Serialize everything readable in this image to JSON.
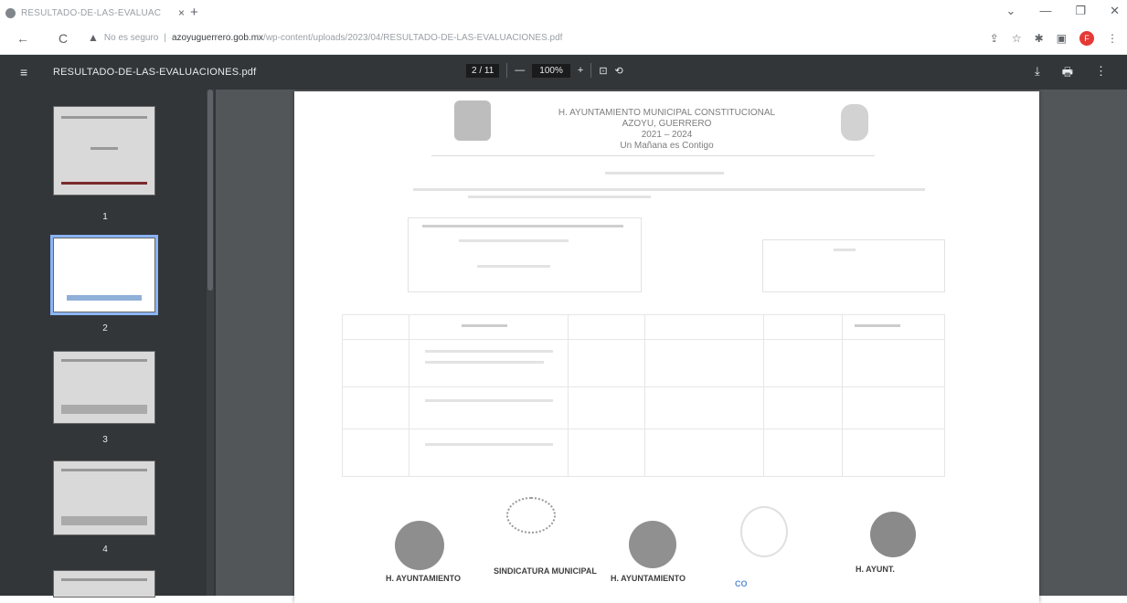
{
  "browser": {
    "tab_title": "RESULTADO-DE-LAS-EVALUAC",
    "tab_close": "×",
    "new_tab": "+",
    "security_label": "No es seguro",
    "url_host": "azoyuguerrero.gob.mx",
    "url_path": "/wp-content/uploads/2023/04/RESULTADO-DE-LAS-EVALUACIONES.pdf",
    "profile_initial": "F",
    "controls": {
      "back": "←",
      "reload": "C",
      "minimize": "—",
      "close": "✕"
    }
  },
  "pdf_toolbar": {
    "menu_icon": "≡",
    "file_name": "RESULTADO-DE-LAS-EVALUACIONES.pdf",
    "current_page": "2",
    "page_separator": "/",
    "total_pages": "11",
    "zoom_out": "—",
    "zoom_level": "100%",
    "zoom_in": "+",
    "download_icon": "⤓",
    "print_icon": "🖶",
    "more_icon": "⋮"
  },
  "thumbnails": [
    {
      "page": "1"
    },
    {
      "page": "2"
    },
    {
      "page": "3"
    },
    {
      "page": "4"
    }
  ],
  "document": {
    "header_line1": "H. AYUNTAMIENTO MUNICIPAL CONSTITUCIONAL",
    "header_line2": "AZOYU, GUERRERO",
    "header_line3": "2021 – 2024",
    "header_line4": "Un Mañana es Contigo",
    "stamp_labels": {
      "s1": "H. AYUNTAMIENTO",
      "s2": "SINDICATURA MUNICIPAL",
      "s3": "H. AYUNTAMIENTO",
      "s4": "CO",
      "s5": "H. AYUNT."
    }
  },
  "colors": {
    "viewer_bg": "#525659",
    "toolbar_bg": "#323639",
    "selected_thumb_outline": "#8ab4f8",
    "stamp_blue": "#5b8ed6"
  }
}
